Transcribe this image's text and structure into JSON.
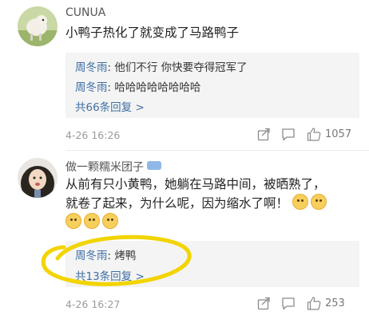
{
  "comments": [
    {
      "username": "CUNUA",
      "text": "小鸭子热化了就变成了马路鸭子",
      "replies": [
        {
          "author": "周冬雨",
          "separator": ": ",
          "text": "他们不行 你快要夺得冠军了"
        },
        {
          "author": "周冬雨",
          "separator": ": ",
          "text": "哈哈哈哈哈哈哈哈"
        }
      ],
      "more_replies": "共66条回复 >",
      "time": "4-26 16:26",
      "likes": "1057"
    },
    {
      "username": "做一颗糯米团子",
      "text_line1": "从前有只小黄鸭，她躺在马路中间，被晒熟了，",
      "text_line2": "就卷了起来，为什么呢，因为缩水了啊！",
      "replies": [
        {
          "author": "周冬雨",
          "separator": ": ",
          "text": "烤鸭"
        }
      ],
      "more_replies": "共13条回复 >",
      "time": "4-26 16:27",
      "likes": "253"
    }
  ],
  "icons": [
    "share-icon",
    "comment-icon",
    "like-icon"
  ],
  "colors": {
    "link": "#3f6fa5",
    "reply_bg": "#f4f4f4",
    "annotation": "#f2d400"
  }
}
